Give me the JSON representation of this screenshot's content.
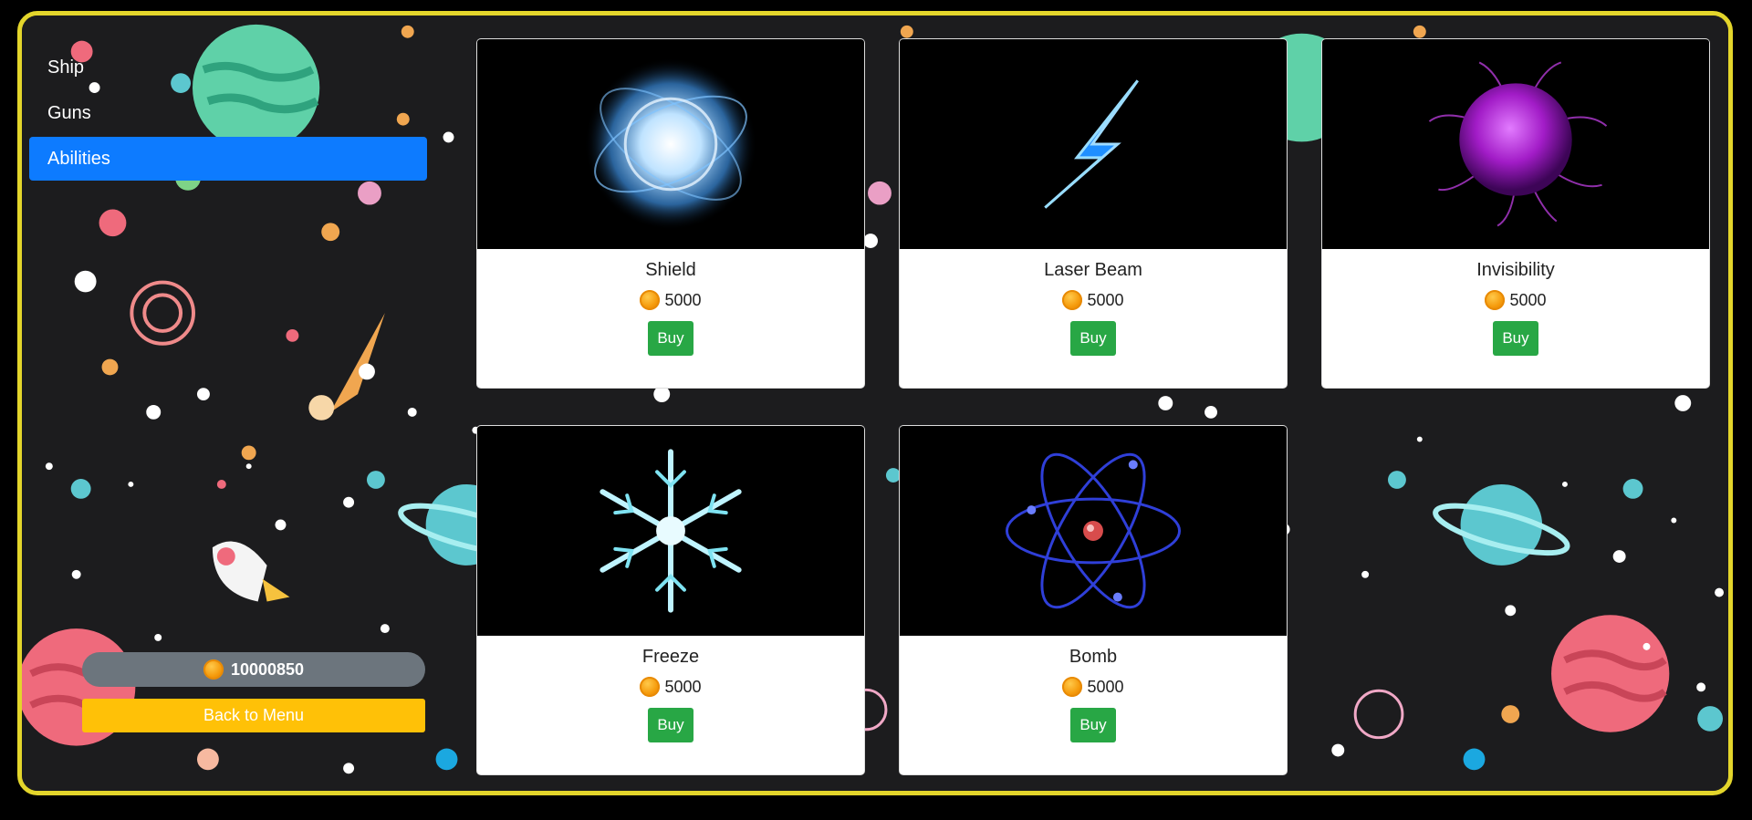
{
  "sidebar": {
    "items": [
      {
        "label": "Ship",
        "active": false
      },
      {
        "label": "Guns",
        "active": false
      },
      {
        "label": "Abilities",
        "active": true
      }
    ],
    "coins": "10000850",
    "back_label": "Back to Menu"
  },
  "abilities": [
    {
      "name": "Shield",
      "price": "5000",
      "buy_label": "Buy",
      "icon": "shield-orb-icon"
    },
    {
      "name": "Laser Beam",
      "price": "5000",
      "buy_label": "Buy",
      "icon": "lightning-bolt-icon"
    },
    {
      "name": "Invisibility",
      "price": "5000",
      "buy_label": "Buy",
      "icon": "purple-orb-icon"
    },
    {
      "name": "Freeze",
      "price": "5000",
      "buy_label": "Buy",
      "icon": "snowflake-icon"
    },
    {
      "name": "Bomb",
      "price": "5000",
      "buy_label": "Buy",
      "icon": "atom-icon"
    }
  ],
  "colors": {
    "frame_border": "#e3d52b",
    "active_tab": "#0d7bff",
    "buy_button": "#28a745",
    "back_button": "#ffc107",
    "coin_pill": "#6c757d"
  }
}
